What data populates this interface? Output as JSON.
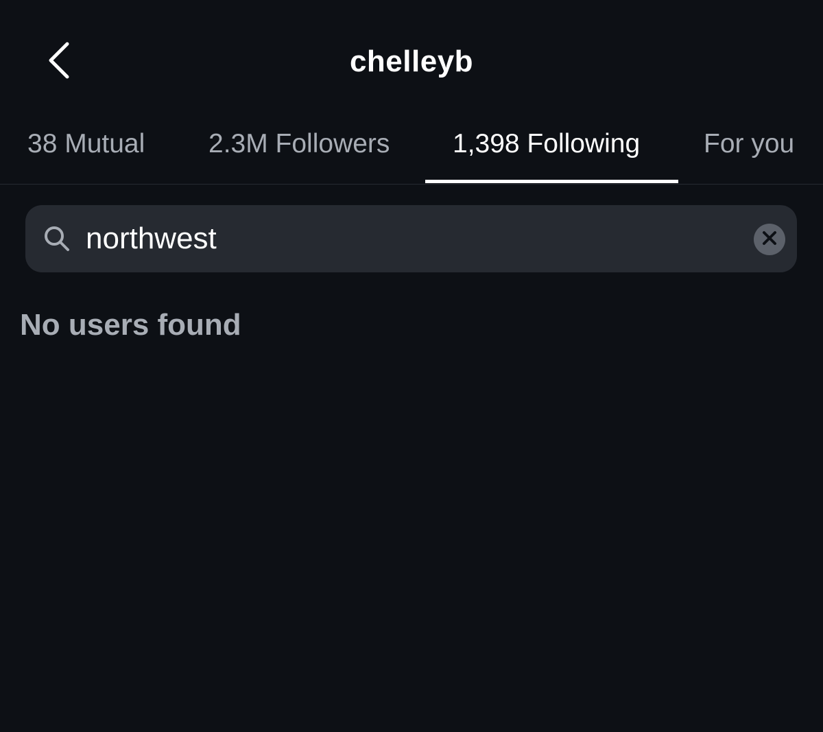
{
  "header": {
    "title": "chelleyb",
    "back_icon": "chevron-left-icon"
  },
  "tabs": [
    {
      "label": "38 Mutual",
      "active": false
    },
    {
      "label": "2.3M Followers",
      "active": false
    },
    {
      "label": "1,398 Following",
      "active": true
    },
    {
      "label": "For you",
      "active": false
    }
  ],
  "search": {
    "value": "northwest",
    "icon": "search-icon",
    "clear_icon": "close-icon"
  },
  "results": {
    "empty_message": "No users found"
  },
  "colors": {
    "background": "#0d1015",
    "search_background": "#262a31",
    "inactive_text": "#a8adb5",
    "active_text": "#ffffff",
    "clear_button": "#5c616a"
  }
}
